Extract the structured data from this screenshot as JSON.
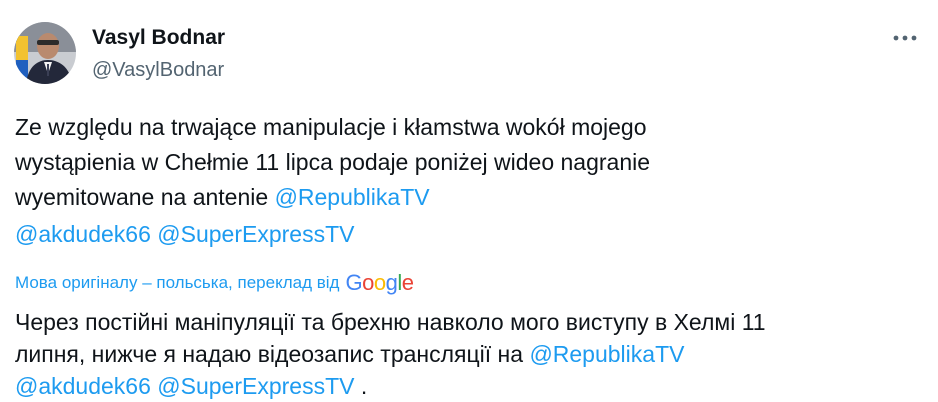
{
  "author": {
    "display_name": "Vasyl Bodnar",
    "handle": "@VasylBodnar"
  },
  "more_button": {
    "icon": "more-horizontal-icon"
  },
  "tweet": {
    "text_line1": "Ze względu na trwające manipulacje i kłamstwa wokół mojego",
    "text_line2": "wystąpienia w Chełmie 11 lipca podaje poniżej wideo nagranie",
    "text_line3_prefix": "wyemitowane na antenie ",
    "mention1": "@RepublikaTV",
    "mention2": "@akdudek66",
    "mention3": "@SuperExpressTV"
  },
  "translation": {
    "note": "Мова оригіналу – польська, переклад від",
    "provider_logo": "Google",
    "line1": "Через постійні маніпуляції та брехню навколо мого виступу в Хелмі 11",
    "line2_prefix": "липня, нижче я надаю відеозапис трансляції на ",
    "mention1": "@RepublikaTV",
    "mention2": "@akdudek66",
    "mention3": "@SuperExpressTV",
    "suffix": " ."
  },
  "colors": {
    "link": "#1d9bf0",
    "secondary_text": "#536471",
    "primary_text": "#0f1419"
  }
}
